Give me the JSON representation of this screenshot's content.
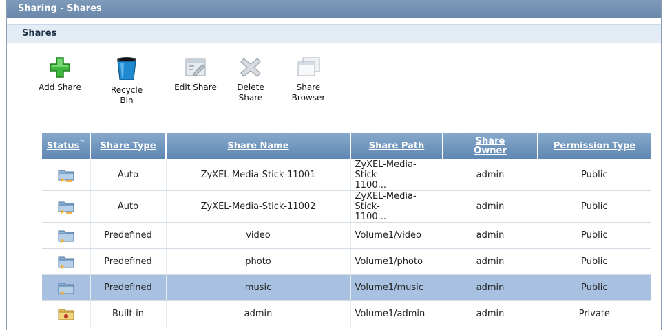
{
  "window": {
    "title": "Sharing - Shares"
  },
  "section": {
    "title": "Shares"
  },
  "toolbar": {
    "add_share": "Add Share",
    "recycle_bin": "Recycle\nBin",
    "edit_share": "Edit Share",
    "delete_share": "Delete\nShare",
    "share_browser": "Share\nBrowser"
  },
  "table": {
    "columns": [
      "Status",
      "Share Type",
      "Share Name",
      "Share Path",
      "Share\nOwner",
      "Permission Type"
    ],
    "sort_indicator": "^",
    "rows": [
      {
        "status_icon": "shared-network-folder-icon",
        "type": "Auto",
        "name": "ZyXEL-Media-Stick-11001",
        "path": "ZyXEL-Media-Stick-\n1100...",
        "owner": "admin",
        "permission": "Public"
      },
      {
        "status_icon": "shared-network-folder-icon",
        "type": "Auto",
        "name": "ZyXEL-Media-Stick-11002",
        "path": "ZyXEL-Media-Stick-\n1100...",
        "owner": "admin",
        "permission": "Public"
      },
      {
        "status_icon": "shared-folder-icon",
        "type": "Predefined",
        "name": "video",
        "path": "Volume1/video",
        "owner": "admin",
        "permission": "Public"
      },
      {
        "status_icon": "shared-folder-icon",
        "type": "Predefined",
        "name": "photo",
        "path": "Volume1/photo",
        "owner": "admin",
        "permission": "Public"
      },
      {
        "status_icon": "shared-folder-icon",
        "type": "Predefined",
        "name": "music",
        "path": "Volume1/music",
        "owner": "admin",
        "permission": "Public"
      },
      {
        "status_icon": "private-folder-icon",
        "type": "Built-in",
        "name": "admin",
        "path": "Volume1/admin",
        "owner": "admin",
        "permission": "Private"
      }
    ]
  },
  "colors": {
    "header": "#6a88ab",
    "selected_row": "#a9c1e0",
    "section_bg": "#e3ebf4"
  }
}
